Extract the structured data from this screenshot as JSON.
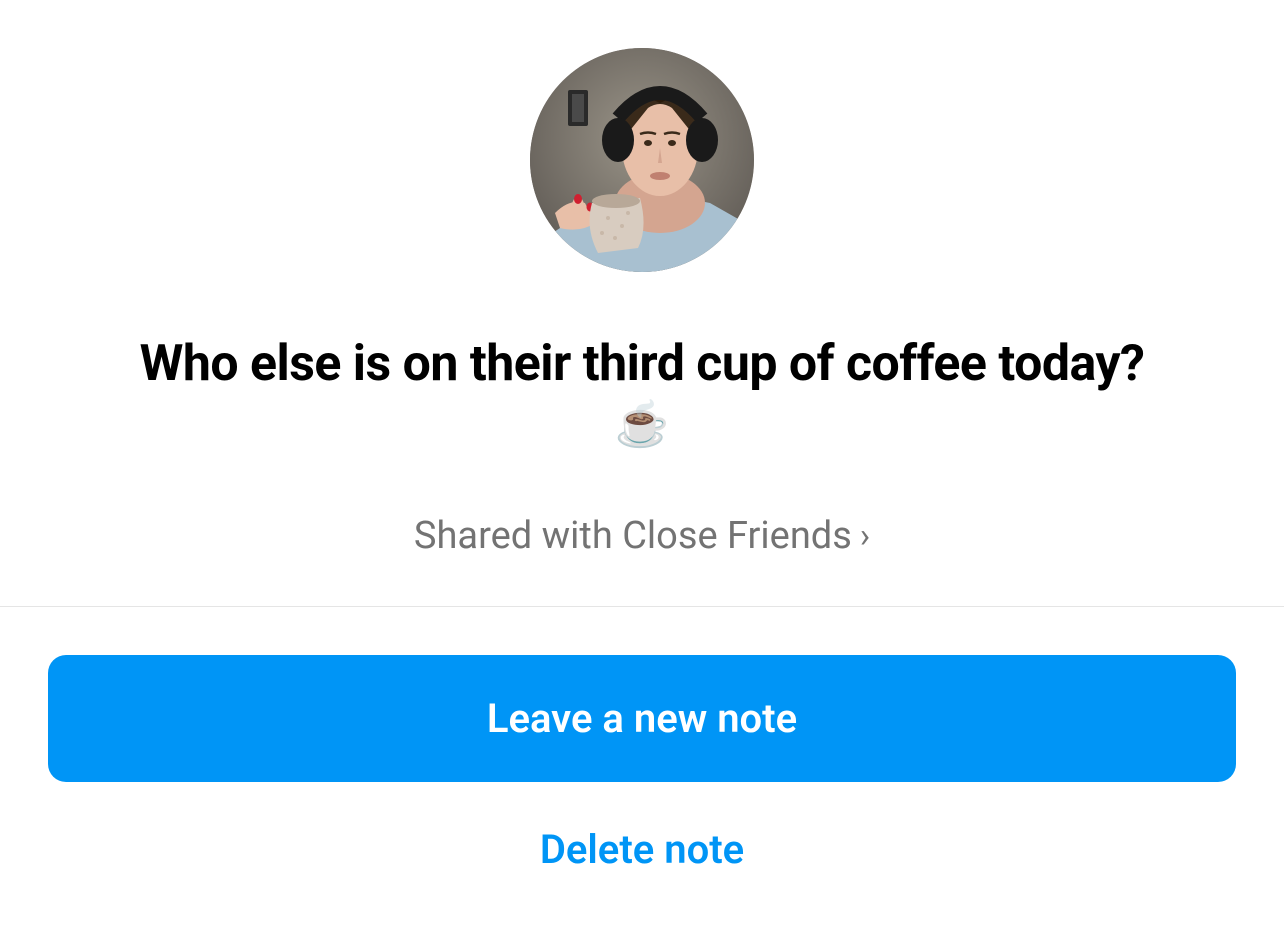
{
  "note": {
    "text": "Who else is on their third cup of coffee today?",
    "emoji": "☕"
  },
  "audience": {
    "label": "Shared with Close Friends"
  },
  "actions": {
    "primary_label": "Leave a new note",
    "secondary_label": "Delete note"
  }
}
